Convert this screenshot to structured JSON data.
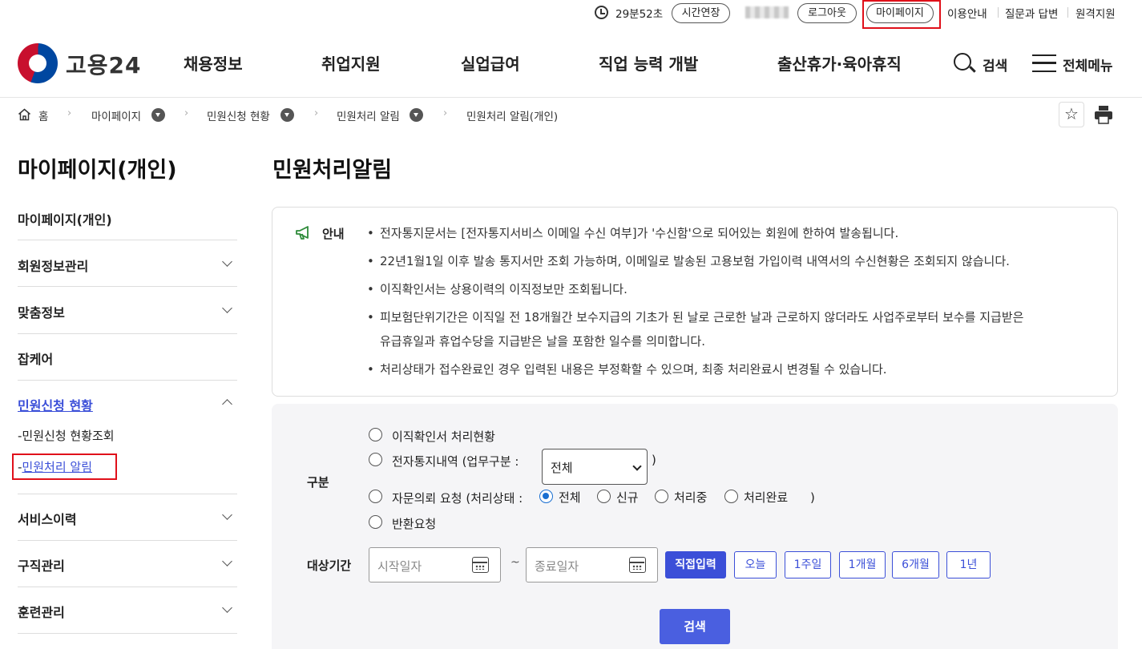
{
  "util": {
    "timer": "29분52초",
    "extend": "시간연장",
    "logout": "로그아웃",
    "mypage": "마이페이지",
    "guide": "이용안내",
    "qna": "질문과 답변",
    "remote": "원격지원"
  },
  "header": {
    "logo": "고용24",
    "nav": [
      "채용정보",
      "취업지원",
      "실업급여",
      "직업 능력 개발",
      "출산휴가·육아휴직"
    ],
    "search": "검색",
    "all_menu": "전체메뉴"
  },
  "breadcrumb": [
    "홈",
    "마이페이지",
    "민원신청 현황",
    "민원처리 알림",
    "민원처리 알림(개인)"
  ],
  "sidebar": {
    "title": "마이페이지(개인)",
    "items": [
      "마이페이지(개인)",
      "회원정보관리",
      "맞춤정보",
      "잡케어",
      "민원신청 현황",
      "서비스이력",
      "구직관리",
      "훈련관리"
    ],
    "subitems": [
      "민원신청 현황조회",
      "민원처리 알림"
    ]
  },
  "main": {
    "title": "민원처리알림",
    "notice_label": "안내",
    "notices": [
      "전자통지문서는 [전자통지서비스 이메일 수신 여부]가 '수신함'으로 되어있는 회원에 한하여 발송됩니다.",
      "22년1월1일 이후 발송 통지서만 조회 가능하며, 이메일로 발송된 고용보험 가입이력 내역서의 수신현황은 조회되지 않습니다.",
      "이직확인서는 상용이력의 이직정보만 조회됩니다.",
      "피보험단위기간은 이직일 전 18개월간 보수지급의 기초가 된 날로 근로한 날과 근로하지 않더라도 사업주로부터 보수를 지급받은",
      "유급휴일과 휴업수당을 지급받은 날을 포함한 일수를 의미합니다.",
      "처리상태가 접수완료인 경우 입력된 내용은 부정확할 수 있으며, 최종 처리완료시 변경될 수 있습니다."
    ]
  },
  "form": {
    "category_label": "구분",
    "opt1": "이직확인서 처리현황",
    "opt2": "전자통지내역 (업무구분 :",
    "opt2_close": ")",
    "select_value": "전체",
    "opt3": "자문의뢰 요청 (처리상태 :",
    "status_options": [
      "전체",
      "신규",
      "처리중",
      "처리완료"
    ],
    "opt3_close": ")",
    "opt4": "반환요청",
    "period_label": "대상기간",
    "start_placeholder": "시작일자",
    "end_placeholder": "종료일자",
    "tilde": "~",
    "period_buttons": [
      "직접입력",
      "오늘",
      "1주일",
      "1개월",
      "6개월",
      "1년"
    ],
    "search_button": "검색"
  },
  "colors": {
    "accent": "#3b4fd8",
    "highlight": "#e0101a"
  }
}
